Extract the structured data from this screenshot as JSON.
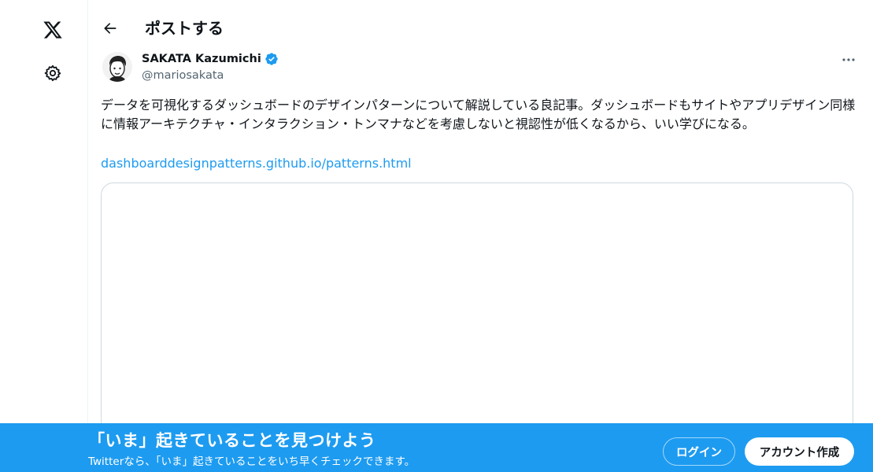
{
  "header": {
    "title": "ポストする"
  },
  "author": {
    "display_name": "SAKATA Kazumichi",
    "handle": "@mariosakata",
    "verified": true
  },
  "tweet": {
    "text": "データを可視化するダッシュボードのデザインパターンについて解説している良記事。ダッシュボードもサイトやアプリデザイン同様に情報アーキテクチャ・インタラクション・トンマナなどを考慮しないと視認性が低くなるから、いい学びになる。",
    "link": "dashboarddesignpatterns.github.io/patterns.html"
  },
  "banner": {
    "title": "「いま」起きていることを見つけよう",
    "subtitle": "Twitterなら、「いま」起きていることをいち早くチェックできます。",
    "login_label": "ログイン",
    "signup_label": "アカウント作成"
  },
  "colors": {
    "accent": "#1d9bf0",
    "text": "#0f1419",
    "secondary_text": "#536471",
    "border": "#cfd9de"
  },
  "icons": {
    "logo": "x-logo-icon",
    "settings": "gear-icon",
    "back": "arrow-left-icon",
    "verified": "verified-badge-icon",
    "more": "more-horizontal-icon"
  }
}
